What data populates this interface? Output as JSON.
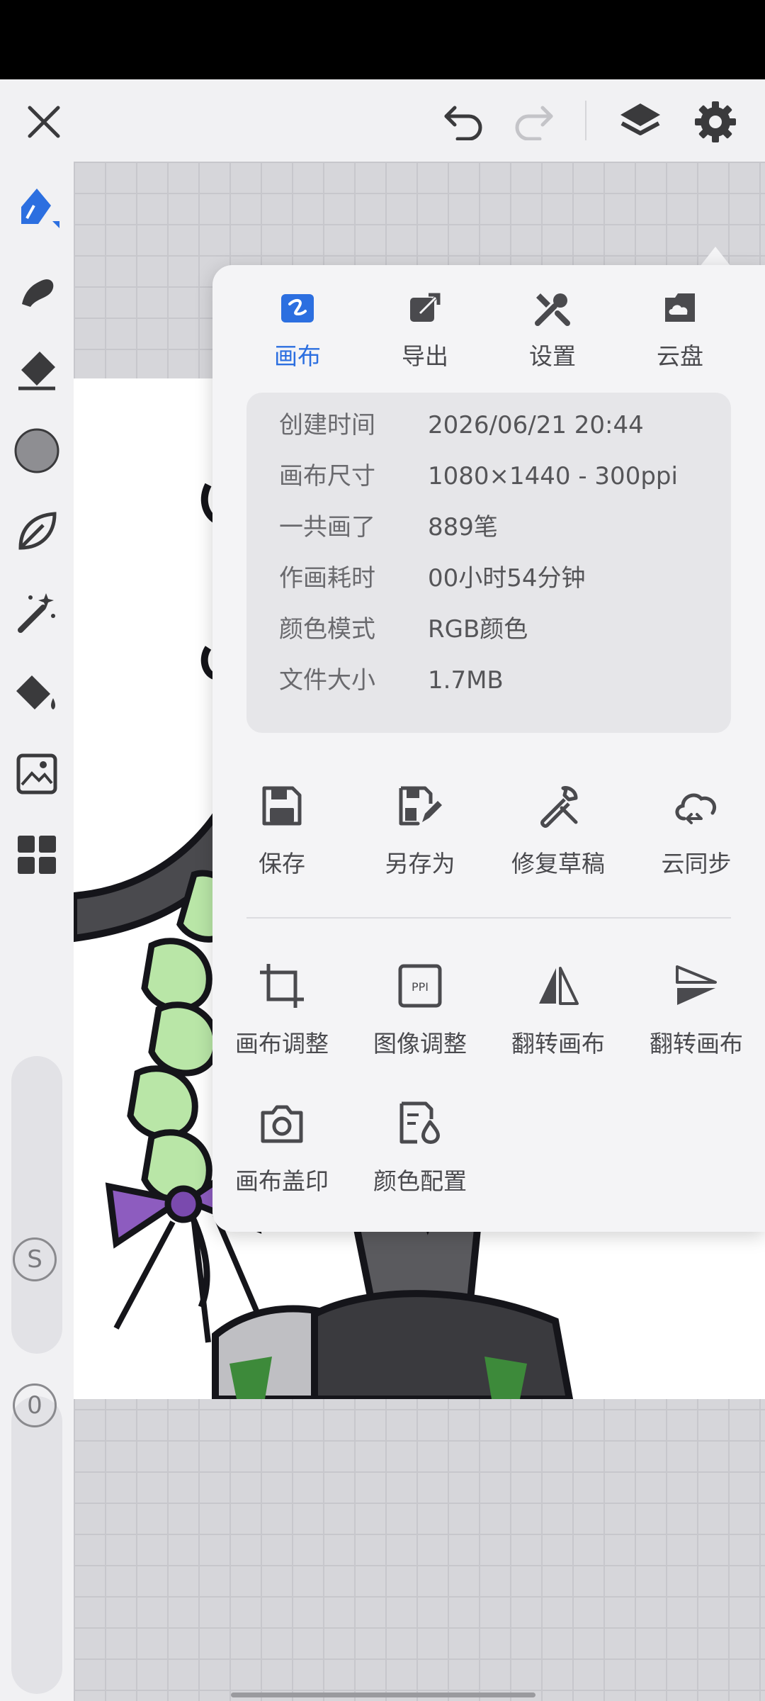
{
  "topbar": {
    "close_icon": "close-icon",
    "undo_icon": "undo-icon",
    "redo_icon": "redo-icon",
    "layers_icon": "layers-icon",
    "settings_icon": "gear-icon"
  },
  "toolbar": {
    "tools": [
      "brush-tool",
      "smudge-tool",
      "eraser-tool",
      "color-swatch",
      "leaf-tool",
      "magic-wand-tool",
      "fill-tool",
      "import-image-tool",
      "grid-menu-tool"
    ],
    "size_slider_label": "S",
    "opacity_slider_label": "0"
  },
  "popover": {
    "tabs": [
      {
        "label": "画布",
        "active": true
      },
      {
        "label": "导出",
        "active": false
      },
      {
        "label": "设置",
        "active": false
      },
      {
        "label": "云盘",
        "active": false
      }
    ],
    "info": [
      {
        "key": "创建时间",
        "value": "2026/06/21 20:44"
      },
      {
        "key": "画布尺寸",
        "value": "1080×1440 - 300ppi"
      },
      {
        "key": "一共画了",
        "value": "889笔"
      },
      {
        "key": "作画耗时",
        "value": "00小时54分钟"
      },
      {
        "key": "颜色模式",
        "value": "RGB颜色"
      },
      {
        "key": "文件大小",
        "value": "1.7MB"
      }
    ],
    "actions_row1": [
      {
        "label": "保存",
        "icon": "save-icon"
      },
      {
        "label": "另存为",
        "icon": "save-as-icon"
      },
      {
        "label": "修复草稿",
        "icon": "wrench-icon"
      },
      {
        "label": "云同步",
        "icon": "cloud-sync-icon"
      }
    ],
    "actions_row2": [
      {
        "label": "画布调整",
        "icon": "crop-icon"
      },
      {
        "label": "图像调整",
        "icon": "ppi-icon"
      },
      {
        "label": "翻转画布",
        "icon": "flip-horizontal-icon"
      },
      {
        "label": "翻转画布",
        "icon": "flip-vertical-icon"
      }
    ],
    "actions_row3": [
      {
        "label": "画布盖印",
        "icon": "camera-icon"
      },
      {
        "label": "颜色配置",
        "icon": "color-profile-icon"
      }
    ],
    "accent_color": "#2c6fe0"
  }
}
